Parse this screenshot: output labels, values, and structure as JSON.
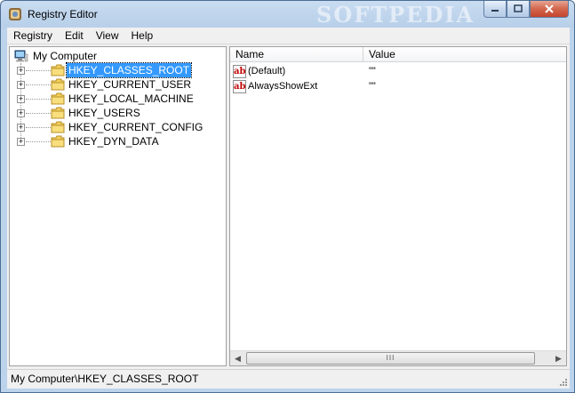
{
  "window": {
    "title": "Registry Editor",
    "watermark": "SOFTPEDIA",
    "icons": {
      "app": "registry-editor-icon",
      "minimize": "minimize-icon",
      "maximize": "maximize-icon",
      "close": "close-icon"
    }
  },
  "menu": {
    "items": [
      "Registry",
      "Edit",
      "View",
      "Help"
    ]
  },
  "tree": {
    "root": {
      "label": "My Computer",
      "icon": "computer-icon"
    },
    "items": [
      {
        "label": "HKEY_CLASSES_ROOT",
        "expander": "+",
        "selected": true
      },
      {
        "label": "HKEY_CURRENT_USER",
        "expander": "+",
        "selected": false
      },
      {
        "label": "HKEY_LOCAL_MACHINE",
        "expander": "+",
        "selected": false
      },
      {
        "label": "HKEY_USERS",
        "expander": "+",
        "selected": false
      },
      {
        "label": "HKEY_CURRENT_CONFIG",
        "expander": "+",
        "selected": false
      },
      {
        "label": "HKEY_DYN_DATA",
        "expander": "+",
        "selected": false
      }
    ],
    "folder_icon": "folder-icon"
  },
  "list": {
    "columns": {
      "name": "Name",
      "value": "Value"
    },
    "rows": [
      {
        "name": "(Default)",
        "value": "\"\"",
        "icon": "string-value-icon"
      },
      {
        "name": "AlwaysShowExt",
        "value": "\"\"",
        "icon": "string-value-icon"
      }
    ],
    "scroll_thumb_glyph": "III"
  },
  "status": {
    "path": "My Computer\\HKEY_CLASSES_ROOT"
  },
  "colors": {
    "selection": "#3399ff",
    "titlebar": "#c9dcf1",
    "close_button": "#c4452c"
  }
}
